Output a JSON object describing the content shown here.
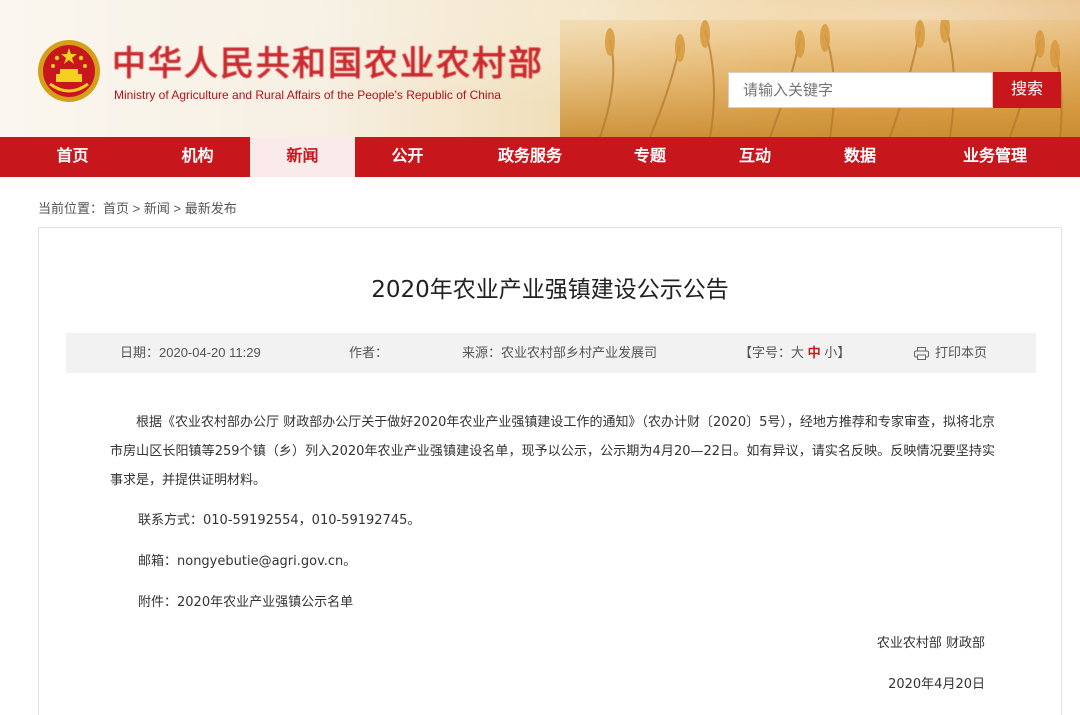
{
  "header": {
    "logo_cn": "中华人民共和国农业农村部",
    "logo_en": "Ministry of Agriculture and Rural Affairs of the People's Republic of China",
    "search_placeholder": "请输入关键字",
    "search_button": "搜索"
  },
  "nav": {
    "items": [
      "首页",
      "机构",
      "新闻",
      "公开",
      "政务服务",
      "专题",
      "互动",
      "数据",
      "业务管理"
    ],
    "active": "新闻"
  },
  "breadcrumb": {
    "prefix": "当前位置：",
    "home": "首页",
    "sep1": " > ",
    "news": "新闻",
    "sep2": " > ",
    "current": "最新发布"
  },
  "article": {
    "title": "2020年农业产业强镇建设公示公告",
    "meta": {
      "date": "日期：2020-04-20 11:29",
      "author": "作者：",
      "source": "来源：农业农村部乡村产业发展司",
      "font_prefix": "【字号：",
      "font_large": "大",
      "font_medium": "中",
      "font_small": "小",
      "font_suffix": "】",
      "print": "打印本页"
    },
    "paragraph1": "根据《农业农村部办公厅 财政部办公厅关于做好2020年农业产业强镇建设工作的通知》（农办计财〔2020〕5号），经地方推荐和专家审查，拟将北京市房山区长阳镇等259个镇（乡）列入2020年农业产业强镇建设名单，现予以公示，公示期为4月20—22日。如有异议，请实名反映。反映情况要坚持实事求是，并提供证明材料。",
    "contact": "联系方式：010-59192554，010-59192745。",
    "email": "邮箱：nongyebutie@agri.gov.cn。",
    "attachment": "附件：2020年农业产业强镇公示名单",
    "signature": "农业农村部 财政部",
    "sign_date": "2020年4月20日"
  }
}
